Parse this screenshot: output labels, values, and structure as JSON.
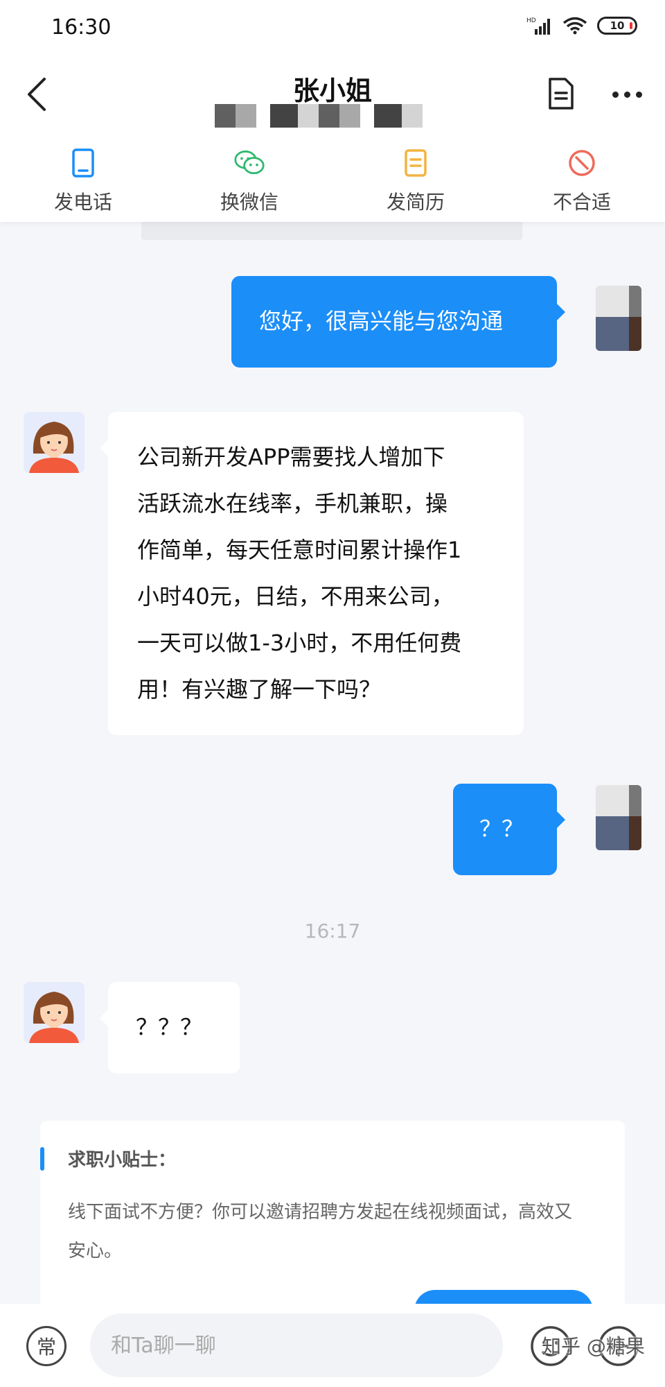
{
  "status_bar": {
    "time": "16:30",
    "battery": "10"
  },
  "header": {
    "name": "张小姐",
    "company": ""
  },
  "actions": [
    {
      "label": "发电话",
      "icon": "phone-icon"
    },
    {
      "label": "换微信",
      "icon": "wechat-icon"
    },
    {
      "label": "发简历",
      "icon": "resume-icon"
    },
    {
      "label": "不合适",
      "icon": "not-suitable-icon"
    }
  ],
  "chat": {
    "messages": [
      {
        "from": "me",
        "text": "您好，很高兴能与您沟通"
      },
      {
        "from": "her",
        "lines": [
          "公司新开发APP需要找人增加下",
          "活跃流水在线率，手机兼职，操",
          "作简单，每天任意时间累计操作1",
          "小时40元，日结，不用来公司，",
          "一天可以做1-3小时，不用任何费",
          "用！有兴趣了解一下吗？"
        ]
      },
      {
        "from": "me",
        "text": "？？"
      },
      {
        "from": "her",
        "text": "？？？"
      }
    ],
    "timestamp": "16:17"
  },
  "tip": {
    "title": "求职小贴士：",
    "lines": [
      "线下面试不方便？你可以邀请招聘方发起在线视频面试，高效又",
      "安心。"
    ]
  },
  "input_bar": {
    "common_label": "常",
    "placeholder": "和Ta聊一聊",
    "watermark": "知乎 @糖果"
  },
  "colors": {
    "accent": "#1b8ef8",
    "wechat": "#2fb86f",
    "resume": "#f2b441",
    "not_suitable": "#ee6a5a"
  }
}
